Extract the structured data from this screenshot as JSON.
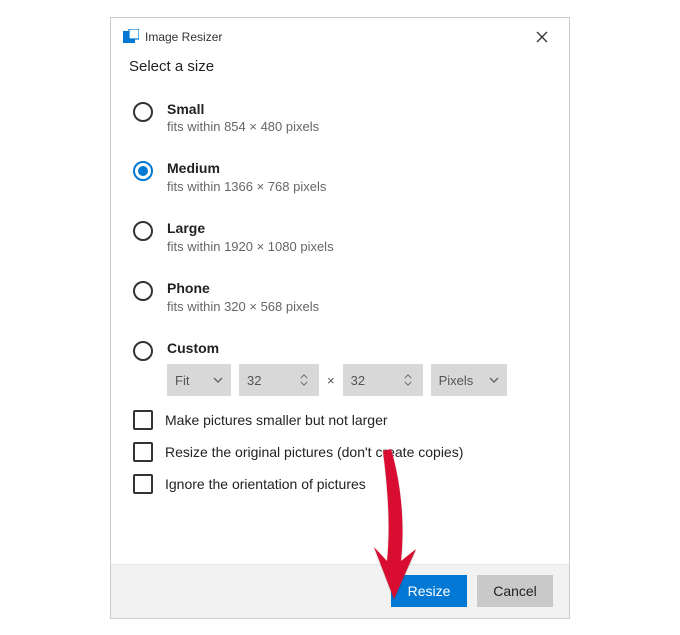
{
  "titlebar": {
    "title": "Image Resizer"
  },
  "heading": "Select a size",
  "options": {
    "small": {
      "label": "Small",
      "sub": "fits within 854 × 480 pixels"
    },
    "medium": {
      "label": "Medium",
      "sub": "fits within 1366 × 768 pixels"
    },
    "large": {
      "label": "Large",
      "sub": "fits within 1920 × 1080 pixels"
    },
    "phone": {
      "label": "Phone",
      "sub": "fits within 320 × 568 pixels"
    },
    "custom": {
      "label": "Custom"
    }
  },
  "custom_controls": {
    "fit": "Fit",
    "width": "32",
    "height": "32",
    "times": "×",
    "unit": "Pixels"
  },
  "checkboxes": {
    "smaller": "Make pictures smaller but not larger",
    "original": "Resize the original pictures (don't create copies)",
    "orientation": "Ignore the orientation of pictures"
  },
  "buttons": {
    "resize": "Resize",
    "cancel": "Cancel"
  },
  "selected": "medium",
  "colors": {
    "accent": "#0078d4"
  }
}
